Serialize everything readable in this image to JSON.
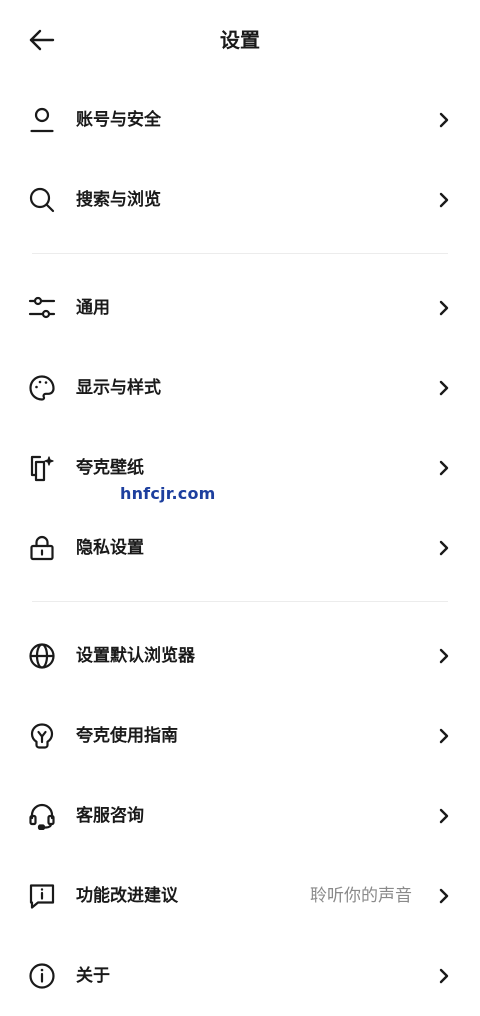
{
  "header": {
    "title": "设置"
  },
  "watermark": "hnfcjr.com",
  "groups": [
    [
      {
        "key": "account",
        "label": "账号与安全",
        "icon": "user-icon"
      },
      {
        "key": "search",
        "label": "搜索与浏览",
        "icon": "search-icon"
      }
    ],
    [
      {
        "key": "general",
        "label": "通用",
        "icon": "sliders-icon"
      },
      {
        "key": "display",
        "label": "显示与样式",
        "icon": "palette-icon"
      },
      {
        "key": "wallpaper",
        "label": "夸克壁纸",
        "icon": "wallpaper-sparkle-icon"
      },
      {
        "key": "privacy",
        "label": "隐私设置",
        "icon": "lock-icon"
      }
    ],
    [
      {
        "key": "default-browser",
        "label": "设置默认浏览器",
        "icon": "globe-icon"
      },
      {
        "key": "guide",
        "label": "夸克使用指南",
        "icon": "lightbulb-icon"
      },
      {
        "key": "support",
        "label": "客服咨询",
        "icon": "headset-icon"
      },
      {
        "key": "feedback",
        "label": "功能改进建议",
        "hint": "聆听你的声音",
        "icon": "feedback-info-icon"
      },
      {
        "key": "about",
        "label": "关于",
        "icon": "info-circle-icon"
      }
    ]
  ]
}
